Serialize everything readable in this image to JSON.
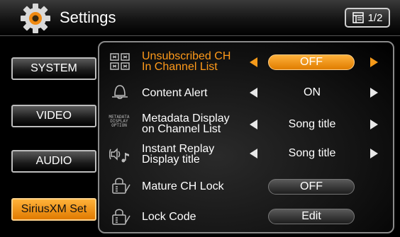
{
  "header": {
    "title": "Settings",
    "page_indicator": "1/2",
    "icons": {
      "settings": "gear-icon",
      "page": "page-list-icon"
    }
  },
  "sidebar": {
    "items": [
      {
        "label": "SYSTEM",
        "active": false
      },
      {
        "label": "VIDEO",
        "active": false
      },
      {
        "label": "AUDIO",
        "active": false
      },
      {
        "label": "SiriusXM Set",
        "active": true
      }
    ]
  },
  "settings": {
    "rows": [
      {
        "icon": "channel-list-icon",
        "label_line1": "Unsubscribed CH",
        "label_line2": "In Channel List",
        "value": "OFF",
        "highlighted": true
      },
      {
        "icon": "alert-bell-icon",
        "label_line1": "Content Alert",
        "value": "ON"
      },
      {
        "icon": "metadata-display-option-icon",
        "icon_text_1": "METADATA",
        "icon_text_2": "DISPLAY",
        "icon_text_3": "OPTION",
        "label_line1": "Metadata Display",
        "label_line2": "on Channel List",
        "value": "Song title"
      },
      {
        "icon": "speaker-note-icon",
        "label_line1": "Instant Replay",
        "label_line2": "Display title",
        "value": "Song title"
      },
      {
        "icon": "lock-icon",
        "label_line1": "Mature CH Lock",
        "value": "OFF"
      },
      {
        "icon": "lock-icon",
        "label_line1": "Lock Code",
        "value": "Edit"
      }
    ]
  },
  "colors": {
    "accent": "#f59a1a",
    "background": "#000000",
    "text": "#ffffff"
  }
}
